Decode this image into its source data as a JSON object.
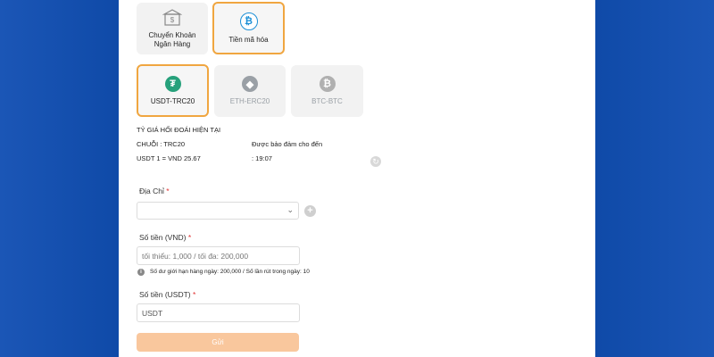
{
  "payment_methods": [
    {
      "label": "Chuyển Khoản Ngân Hàng",
      "icon": "bank-icon"
    },
    {
      "label": "Tiền mã hóa",
      "icon": "bitcoin-icon"
    }
  ],
  "crypto_options": [
    {
      "label": "USDT-TRC20",
      "icon": "tether-icon",
      "color": "#26a17b"
    },
    {
      "label": "ETH-ERC20",
      "icon": "ethereum-icon",
      "color": "#9aa0a6"
    },
    {
      "label": "BTC-BTC",
      "icon": "bitcoin-icon",
      "color": "#b0b0b0"
    }
  ],
  "rate": {
    "title": "TỶ GIÁ HỐI ĐOÁI HIỆN TẠI",
    "chain": "CHUỖI : TRC20",
    "guaranteed": "Được bảo đảm cho đến",
    "value": "USDT 1 = VND 25.67",
    "time": ": 19:07"
  },
  "address": {
    "label": "Địa Chỉ",
    "required": "*"
  },
  "amount_vnd": {
    "label": "Số tiền (VND)",
    "required": "*",
    "placeholder": "tối thiểu: 1,000 / tối đa: 200,000",
    "info": "Số dư giới hạn hàng ngày: 200,000 / Số lần rút trong ngày: 10"
  },
  "amount_usdt": {
    "label": "Số tiền (USDT)",
    "required": "*",
    "placeholder": "USDT"
  },
  "submit_label": "Gửi",
  "colors": {
    "accent": "#f0a640",
    "submit": "#f9c79d",
    "background": "#0f4aa8"
  }
}
